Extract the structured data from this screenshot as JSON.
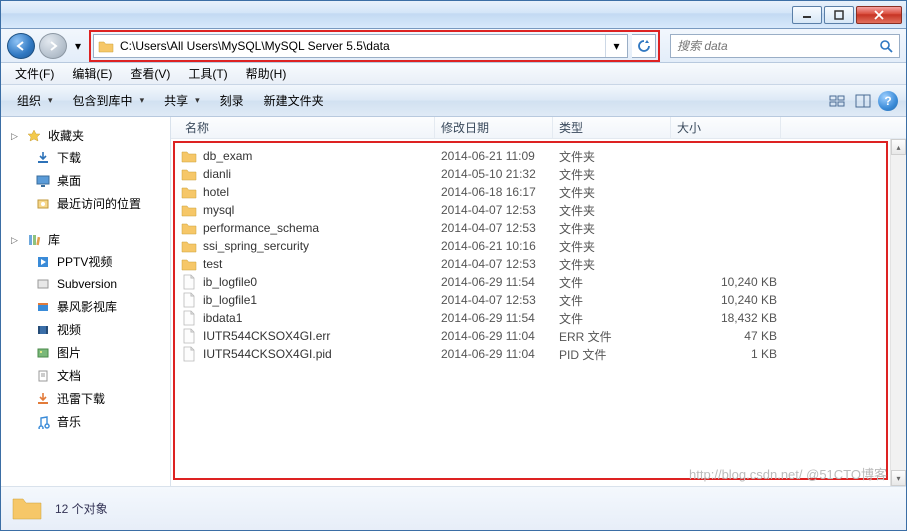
{
  "address_path": "C:\\Users\\All Users\\MySQL\\MySQL Server 5.5\\data",
  "search_placeholder": "搜索 data",
  "menu": {
    "file": "文件(F)",
    "edit": "编辑(E)",
    "view": "查看(V)",
    "tools": "工具(T)",
    "help": "帮助(H)"
  },
  "toolbar": {
    "organize": "组织",
    "include": "包含到库中",
    "share": "共享",
    "burn": "刻录",
    "newfolder": "新建文件夹"
  },
  "columns": {
    "name": "名称",
    "date": "修改日期",
    "type": "类型",
    "size": "大小"
  },
  "sidebar": {
    "favorites": {
      "label": "收藏夹",
      "items": [
        {
          "icon": "download",
          "label": "下载"
        },
        {
          "icon": "desktop",
          "label": "桌面"
        },
        {
          "icon": "recent",
          "label": "最近访问的位置"
        }
      ]
    },
    "libraries": {
      "label": "库",
      "items": [
        {
          "icon": "pptv",
          "label": "PPTV视频"
        },
        {
          "icon": "svn",
          "label": "Subversion"
        },
        {
          "icon": "storm",
          "label": "暴风影视库"
        },
        {
          "icon": "video",
          "label": "视频"
        },
        {
          "icon": "pic",
          "label": "图片"
        },
        {
          "icon": "doc",
          "label": "文档"
        },
        {
          "icon": "xunlei",
          "label": "迅雷下载"
        },
        {
          "icon": "music",
          "label": "音乐"
        }
      ]
    }
  },
  "type_labels": {
    "folder": "文件夹",
    "file": "文件",
    "err": "ERR 文件",
    "pid": "PID 文件"
  },
  "files": [
    {
      "icon": "folder",
      "name": "db_exam",
      "date": "2014-06-21 11:09",
      "type": "folder",
      "size": ""
    },
    {
      "icon": "folder",
      "name": "dianli",
      "date": "2014-05-10 21:32",
      "type": "folder",
      "size": ""
    },
    {
      "icon": "folder",
      "name": "hotel",
      "date": "2014-06-18 16:17",
      "type": "folder",
      "size": ""
    },
    {
      "icon": "folder",
      "name": "mysql",
      "date": "2014-04-07 12:53",
      "type": "folder",
      "size": ""
    },
    {
      "icon": "folder",
      "name": "performance_schema",
      "date": "2014-04-07 12:53",
      "type": "folder",
      "size": ""
    },
    {
      "icon": "folder",
      "name": "ssi_spring_sercurity",
      "date": "2014-06-21 10:16",
      "type": "folder",
      "size": ""
    },
    {
      "icon": "folder",
      "name": "test",
      "date": "2014-04-07 12:53",
      "type": "folder",
      "size": ""
    },
    {
      "icon": "file",
      "name": "ib_logfile0",
      "date": "2014-06-29 11:54",
      "type": "file",
      "size": "10,240 KB"
    },
    {
      "icon": "file",
      "name": "ib_logfile1",
      "date": "2014-04-07 12:53",
      "type": "file",
      "size": "10,240 KB"
    },
    {
      "icon": "file",
      "name": "ibdata1",
      "date": "2014-06-29 11:54",
      "type": "file",
      "size": "18,432 KB"
    },
    {
      "icon": "file",
      "name": "IUTR544CKSOX4GI.err",
      "date": "2014-06-29 11:04",
      "type": "err",
      "size": "47 KB"
    },
    {
      "icon": "file",
      "name": "IUTR544CKSOX4GI.pid",
      "date": "2014-06-29 11:04",
      "type": "pid",
      "size": "1 KB"
    }
  ],
  "status": {
    "count_text": "12 个对象"
  },
  "watermark": "http://blog.csdn.net/ @51CTO博客"
}
